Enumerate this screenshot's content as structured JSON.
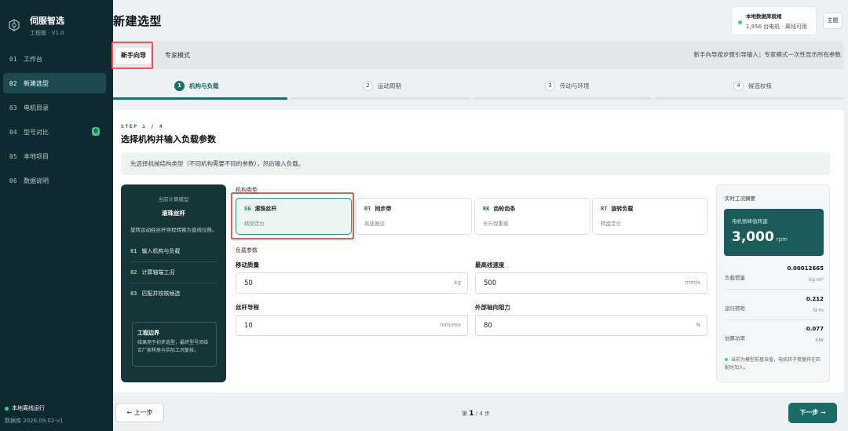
{
  "brand": {
    "name": "伺服智选",
    "edition": "工程版 · V1.0"
  },
  "nav": [
    {
      "num": "01",
      "label": "工作台"
    },
    {
      "num": "02",
      "label": "新建选型",
      "active": true
    },
    {
      "num": "03",
      "label": "电机目录"
    },
    {
      "num": "04",
      "label": "型号对比",
      "badge": "0"
    },
    {
      "num": "05",
      "label": "本地项目"
    },
    {
      "num": "06",
      "label": "数据说明"
    }
  ],
  "sidebar_footer": {
    "status": "本地离线运行",
    "db_version": "数据库 2026.09.02-v1"
  },
  "page": {
    "title": "新建选型"
  },
  "db_status": {
    "title": "本地数据库就绪",
    "sub": "1,956 台电机 · 离线可用"
  },
  "theme_button": "主题",
  "modes": {
    "beginner": "新手向导",
    "expert": "专家模式",
    "hint": "新手向导按步骤引导输入；专家模式一次性显示所有参数"
  },
  "steps": [
    {
      "num": "1",
      "label": "机构与负载"
    },
    {
      "num": "2",
      "label": "运动周期"
    },
    {
      "num": "3",
      "label": "传动与环境"
    },
    {
      "num": "4",
      "label": "候选校核"
    }
  ],
  "step_tag": "STEP 1 / 4",
  "section_title": "选择机构并输入负载参数",
  "info_banner": "先选择机械结构类型（不同机构需要不同的参数），然后输入负载。",
  "calc_panel": {
    "caption": "当前计算模型",
    "model": "滚珠丝杆",
    "desc": "旋转运动经丝杆导程转换为直线位移。",
    "steps": [
      {
        "n": "01",
        "label": "输入机构与负载"
      },
      {
        "n": "02",
        "label": "计算轴端工况"
      },
      {
        "n": "03",
        "label": "匹配并校核候选"
      }
    ],
    "bound_title": "工程边界",
    "bound_text": "结果用于初步选型，最终型号须结合厂家样册与实际工况复核。"
  },
  "mechanism": {
    "label": "机构类型",
    "cards": [
      {
        "code": "SG",
        "name": "滚珠丝杆",
        "desc": "精密定位",
        "active": true
      },
      {
        "code": "BT",
        "name": "同步带",
        "desc": "高速搬运"
      },
      {
        "code": "RK",
        "name": "齿轮齿条",
        "desc": "长行程重载"
      },
      {
        "code": "RT",
        "name": "旋转负载",
        "desc": "转盘定位"
      }
    ]
  },
  "load": {
    "label": "负载参数",
    "fields": {
      "mass": {
        "label": "移动质量",
        "value": "50",
        "unit": "kg"
      },
      "speed": {
        "label": "最高线速度",
        "value": "500",
        "unit": "mm/s"
      },
      "lead": {
        "label": "丝杆导程",
        "value": "10",
        "unit": "mm/rev"
      },
      "force": {
        "label": "外部轴向阻力",
        "value": "80",
        "unit": "N"
      }
    }
  },
  "summary": {
    "caption": "实时工况摘要",
    "hero_label": "电机侧峰值转速",
    "hero_value": "3,000",
    "hero_unit": "rpm",
    "rows": [
      {
        "label": "负载惯量",
        "value": "0.00012665",
        "unit": "kg·m²"
      },
      {
        "label": "运行转矩",
        "value": "0.212",
        "unit": "N·m"
      },
      {
        "label": "估算功率",
        "value": "0.077",
        "unit": "kW"
      }
    ],
    "note": "当前为模型前基准值，电机转子惯量将在匹配时加入。"
  },
  "footer": {
    "prev": "← 上一步",
    "pager_prefix": "第",
    "pager_current": "1",
    "pager_suffix": "/ 4 步",
    "next": "下一步 →"
  },
  "colors": {
    "accent": "#1b6b66",
    "sidebar": "#0e2a30",
    "highlight": "#e8585a",
    "status_green": "#3fcf8e"
  }
}
